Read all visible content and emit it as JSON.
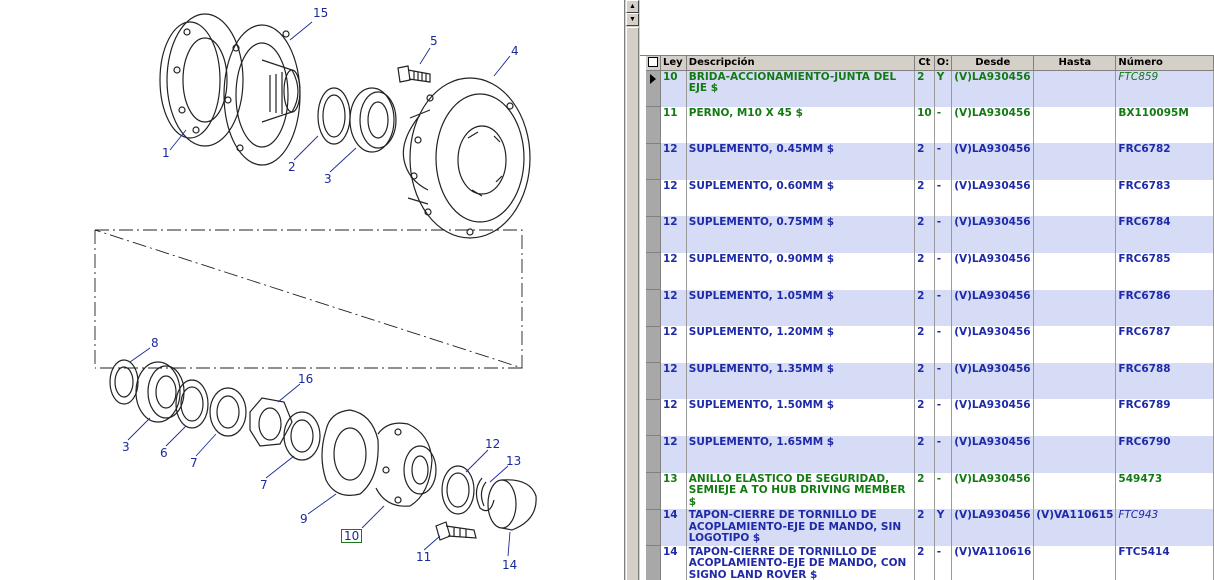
{
  "diagram": {
    "callouts": [
      "15",
      "5",
      "4",
      "1",
      "2",
      "3",
      "8",
      "16",
      "3",
      "6",
      "7",
      "7",
      "12",
      "13",
      "9",
      "10",
      "11",
      "14"
    ],
    "selected_callout": "10"
  },
  "table": {
    "headers": [
      "Ley",
      "Descripción",
      "Ct",
      "O:",
      "Desde",
      "Hasta",
      "Número"
    ],
    "rows": [
      {
        "ley": "10",
        "desc": "BRIDA-ACCIONAMIENTO-JUNTA DEL EJE $",
        "ct": "2",
        "o": "Y",
        "desde": "(V)LA930456",
        "hasta": "",
        "numero": "FTC859",
        "color": "green"
      },
      {
        "ley": "11",
        "desc": "PERNO, M10 X 45 $",
        "ct": "10",
        "o": "-",
        "desde": "(V)LA930456",
        "hasta": "",
        "numero": "BX110095M",
        "color": "green"
      },
      {
        "ley": "12",
        "desc": "SUPLEMENTO, 0.45MM $",
        "ct": "2",
        "o": "-",
        "desde": "(V)LA930456",
        "hasta": "",
        "numero": "FRC6782",
        "color": "blue"
      },
      {
        "ley": "12",
        "desc": "SUPLEMENTO, 0.60MM $",
        "ct": "2",
        "o": "-",
        "desde": "(V)LA930456",
        "hasta": "",
        "numero": "FRC6783",
        "color": "blue"
      },
      {
        "ley": "12",
        "desc": "SUPLEMENTO, 0.75MM $",
        "ct": "2",
        "o": "-",
        "desde": "(V)LA930456",
        "hasta": "",
        "numero": "FRC6784",
        "color": "blue"
      },
      {
        "ley": "12",
        "desc": "SUPLEMENTO, 0.90MM $",
        "ct": "2",
        "o": "-",
        "desde": "(V)LA930456",
        "hasta": "",
        "numero": "FRC6785",
        "color": "blue"
      },
      {
        "ley": "12",
        "desc": "SUPLEMENTO, 1.05MM $",
        "ct": "2",
        "o": "-",
        "desde": "(V)LA930456",
        "hasta": "",
        "numero": "FRC6786",
        "color": "blue"
      },
      {
        "ley": "12",
        "desc": "SUPLEMENTO, 1.20MM $",
        "ct": "2",
        "o": "-",
        "desde": "(V)LA930456",
        "hasta": "",
        "numero": "FRC6787",
        "color": "blue"
      },
      {
        "ley": "12",
        "desc": "SUPLEMENTO, 1.35MM $",
        "ct": "2",
        "o": "-",
        "desde": "(V)LA930456",
        "hasta": "",
        "numero": "FRC6788",
        "color": "blue"
      },
      {
        "ley": "12",
        "desc": "SUPLEMENTO, 1.50MM $",
        "ct": "2",
        "o": "-",
        "desde": "(V)LA930456",
        "hasta": "",
        "numero": "FRC6789",
        "color": "blue"
      },
      {
        "ley": "12",
        "desc": "SUPLEMENTO, 1.65MM $",
        "ct": "2",
        "o": "-",
        "desde": "(V)LA930456",
        "hasta": "",
        "numero": "FRC6790",
        "color": "blue"
      },
      {
        "ley": "13",
        "desc": "ANILLO ELÁSTICO DE SEGURIDAD, SEMIEJE A TO HUB DRIVING MEMBER $",
        "ct": "2",
        "o": "-",
        "desde": "(V)LA930456",
        "hasta": "",
        "numero": "549473",
        "color": "green"
      },
      {
        "ley": "14",
        "desc": "TAPÓN-CIERRE DE TORNILLO DE ACOPLAMIENTO-EJE DE MANDO, SIN LOGOTIPO $",
        "ct": "2",
        "o": "Y",
        "desde": "(V)LA930456",
        "hasta": "(V)VA110615",
        "numero": "FTC943",
        "color": "blue"
      },
      {
        "ley": "14",
        "desc": "TAPÓN-CIERRE DE TORNILLO DE ACOPLAMIENTO-EJE DE MANDO, CON SIGNO LAND ROVER $",
        "ct": "2",
        "o": "-",
        "desde": "(V)VA110616",
        "hasta": "",
        "numero": "FTC5414",
        "color": "blue"
      }
    ]
  }
}
